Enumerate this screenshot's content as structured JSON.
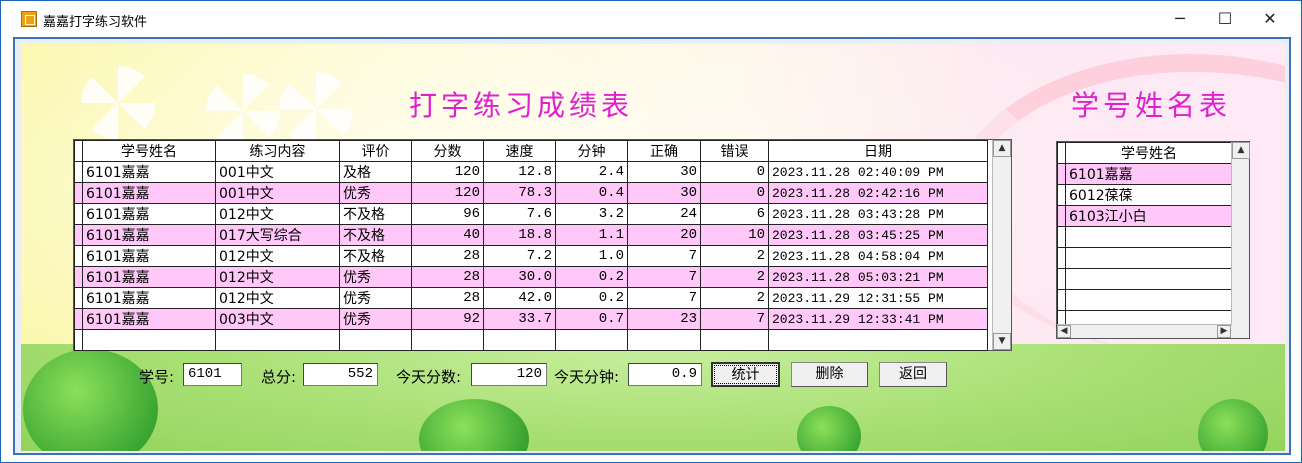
{
  "window": {
    "title": "嘉嘉打字练习软件",
    "minimize": "─",
    "maximize": "☐",
    "close": "✕"
  },
  "headings": {
    "scores": "打字练习成绩表",
    "names": "学号姓名表"
  },
  "scores_table": {
    "columns": [
      "学号姓名",
      "练习内容",
      "评价",
      "分数",
      "速度",
      "分钟",
      "正确",
      "错误",
      "日期"
    ],
    "rows": [
      [
        "6101嘉嘉",
        "001中文",
        "及格",
        "120",
        "12.8",
        "2.4",
        "30",
        "0",
        "2023.11.28 02:40:09 PM"
      ],
      [
        "6101嘉嘉",
        "001中文",
        "优秀",
        "120",
        "78.3",
        "0.4",
        "30",
        "0",
        "2023.11.28 02:42:16 PM"
      ],
      [
        "6101嘉嘉",
        "012中文",
        "不及格",
        "96",
        "7.6",
        "3.2",
        "24",
        "6",
        "2023.11.28 03:43:28 PM"
      ],
      [
        "6101嘉嘉",
        "017大写综合",
        "不及格",
        "40",
        "18.8",
        "1.1",
        "20",
        "10",
        "2023.11.28 03:45:25 PM"
      ],
      [
        "6101嘉嘉",
        "012中文",
        "不及格",
        "28",
        "7.2",
        "1.0",
        "7",
        "2",
        "2023.11.28 04:58:04 PM"
      ],
      [
        "6101嘉嘉",
        "012中文",
        "优秀",
        "28",
        "30.0",
        "0.2",
        "7",
        "2",
        "2023.11.28 05:03:21 PM"
      ],
      [
        "6101嘉嘉",
        "012中文",
        "优秀",
        "28",
        "42.0",
        "0.2",
        "7",
        "2",
        "2023.11.29 12:31:55 PM"
      ],
      [
        "6101嘉嘉",
        "003中文",
        "优秀",
        "92",
        "33.7",
        "0.7",
        "23",
        "7",
        "2023.11.29 12:33:41 PM"
      ]
    ],
    "scroll_up": "▲",
    "scroll_down": "▼"
  },
  "names_table": {
    "header": "学号姓名",
    "rows": [
      "6101嘉嘉",
      "6012葆葆",
      "6103江小白"
    ],
    "scroll_up": "▲",
    "scroll_left": "◀",
    "scroll_right": "▶"
  },
  "form": {
    "student_id_label": "学号:",
    "student_id_value": "6101",
    "total_label": "总分:",
    "total_value": "552",
    "today_score_label": "今天分数:",
    "today_score_value": "120",
    "today_minutes_label": "今天分钟:",
    "today_minutes_value": "0.9",
    "stats_button": "统计",
    "delete_button": "删除",
    "back_button": "返回"
  }
}
